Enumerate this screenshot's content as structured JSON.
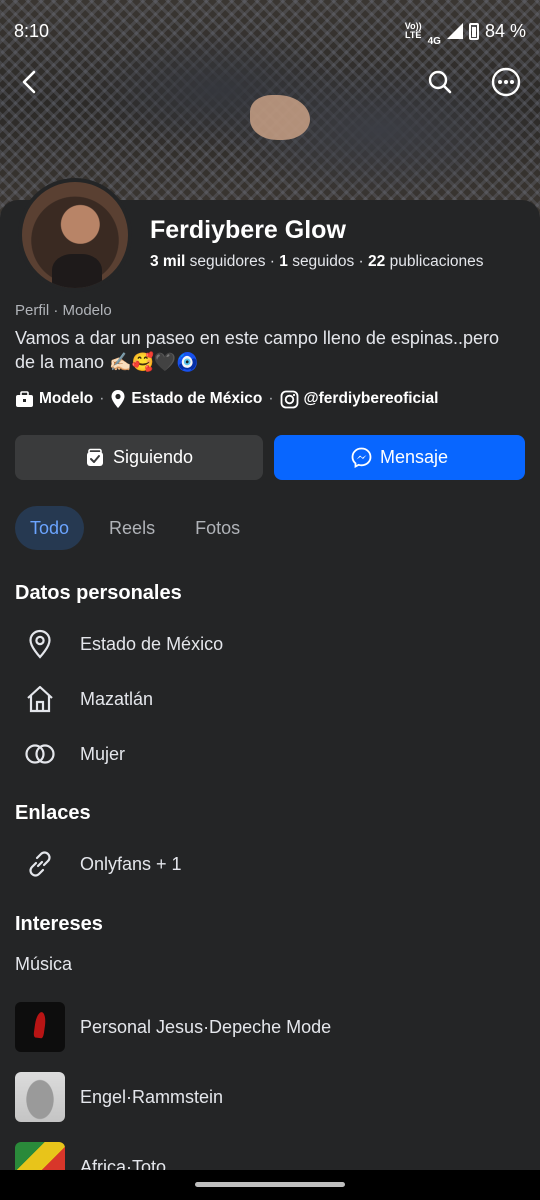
{
  "status_bar": {
    "time": "8:10",
    "network_top": "Vo))",
    "network_bottom": "LTE",
    "network_type": "4G",
    "battery": "84 %"
  },
  "profile": {
    "name": "Ferdiybere Glow",
    "followers_count": "3 mil",
    "followers_label": "seguidores",
    "following_count": "1",
    "following_label": "seguidos",
    "posts_count": "22",
    "posts_label": "publicaciones",
    "category": "Perfil · Modelo",
    "bio_line1": "Vamos a dar un paseo en este campo lleno de espinas..pero",
    "bio_line2": "de la mano ✍🏻🥰🖤🧿",
    "info_role": "Modelo",
    "info_location": "Estado de México",
    "info_instagram": "@ferdiybereoficial"
  },
  "actions": {
    "following_label": "Siguiendo",
    "message_label": "Mensaje"
  },
  "tabs": [
    {
      "label": "Todo"
    },
    {
      "label": "Reels"
    },
    {
      "label": "Fotos"
    }
  ],
  "personal": {
    "title": "Datos personales",
    "items": [
      {
        "label": "Estado de México",
        "icon": "location-pin-icon"
      },
      {
        "label": "Mazatlán",
        "icon": "home-icon"
      },
      {
        "label": "Mujer",
        "icon": "gender-icon"
      }
    ]
  },
  "links": {
    "title": "Enlaces",
    "items": [
      {
        "label": "Onlyfans + 1",
        "icon": "link-icon"
      }
    ]
  },
  "interests": {
    "title": "Intereses",
    "music_label": "Música",
    "items": [
      {
        "label": "Personal Jesus·Depeche Mode"
      },
      {
        "label": "Engel·Rammstein"
      },
      {
        "label": "Africa·Toto"
      }
    ]
  },
  "colors": {
    "background": "#242526",
    "accent": "#0866ff",
    "tab_active_bg": "#263951",
    "tab_active_text": "#6ba4ff"
  }
}
